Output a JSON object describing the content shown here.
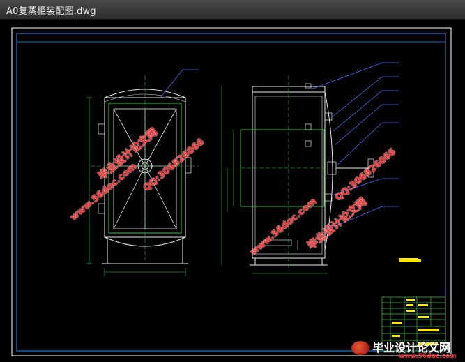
{
  "window": {
    "title": "A0复蒸柜装配图.dwg"
  },
  "watermarks": {
    "site_cn": "毕业设计论文网",
    "site_url": "www.56doc.com",
    "qq": "QQ:306826066",
    "footer_brand": "毕业设计论文网",
    "footer_url": "www.56doc.com"
  },
  "colors": {
    "background": "#000000",
    "frame_outer": "#ffffff",
    "frame_inner": "#1e90ff",
    "drawing_green": "#2ecc40",
    "drawing_white": "#e6e6e6",
    "leader_blue": "#4a6cff",
    "title_block_yellow": "#ffe600",
    "watermark_red": "#ff2a2a"
  }
}
